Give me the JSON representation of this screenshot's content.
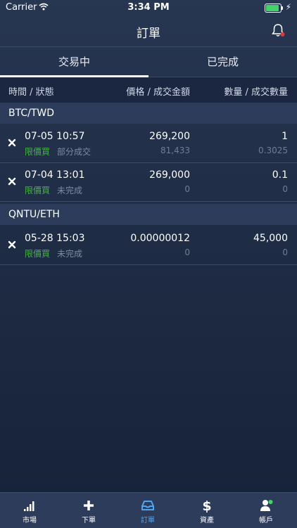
{
  "status_bar": {
    "carrier": "Carrier",
    "time": "3:34 PM"
  },
  "nav": {
    "title": "訂單"
  },
  "tabs": [
    {
      "label": "交易中",
      "active": true
    },
    {
      "label": "已完成",
      "active": false
    }
  ],
  "columns": {
    "time_status": "時間 / 狀態",
    "price_amount": "價格 / 成交金額",
    "qty_filled": "數量 / 成交數量"
  },
  "groups": [
    {
      "pair": "BTC/TWD",
      "orders": [
        {
          "datetime": "07-05 10:57",
          "type": "限價買",
          "status": "部分成交",
          "price": "269,200",
          "filled_amount": "81,433",
          "quantity": "1",
          "filled_quantity": "0.3025"
        },
        {
          "datetime": "07-04 13:01",
          "type": "限價買",
          "status": "未完成",
          "price": "269,000",
          "filled_amount": "0",
          "quantity": "0.1",
          "filled_quantity": "0"
        }
      ]
    },
    {
      "pair": "QNTU/ETH",
      "orders": [
        {
          "datetime": "05-28 15:03",
          "type": "限價買",
          "status": "未完成",
          "price": "0.00000012",
          "filled_amount": "0",
          "quantity": "45,000",
          "filled_quantity": "0"
        }
      ]
    }
  ],
  "tabbar": [
    {
      "label": "市場",
      "icon": "signal-bars-icon",
      "active": false
    },
    {
      "label": "下單",
      "icon": "plus-icon",
      "active": false
    },
    {
      "label": "訂單",
      "icon": "tray-icon",
      "active": true
    },
    {
      "label": "資產",
      "icon": "dollar-icon",
      "active": false
    },
    {
      "label": "帳戶",
      "icon": "user-icon",
      "active": false
    }
  ],
  "colors": {
    "accent": "#4ea5f2",
    "buy_green": "#46b246",
    "notify_red": "#e5343d",
    "online_green": "#44d36b"
  }
}
